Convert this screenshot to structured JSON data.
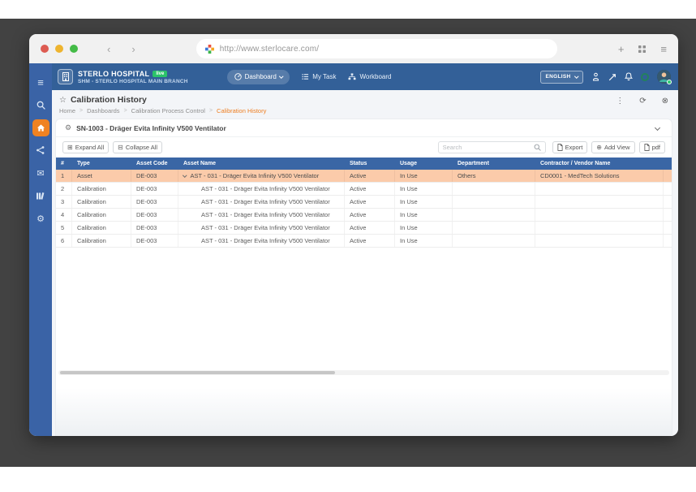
{
  "colors": {
    "accent_orange": "#ef8222",
    "appbar_blue": "#336098",
    "sidebar_blue": "#3a63a6",
    "table_header_blue": "#3a66a5",
    "row_highlight": "#fbcbaa",
    "live_green": "#2bc36a"
  },
  "browser": {
    "url": "http://www.sterlocare.com/"
  },
  "icons": {
    "hamburger": "≡",
    "plus": "+",
    "back": "‹",
    "forward": "›",
    "kebab": "⋮",
    "refresh": "⟳",
    "close_circle": "⊗",
    "star": "☆",
    "gear": "⚙",
    "mail": "✉",
    "add_view_plus": "⊕",
    "expand": "⊞",
    "collapse": "⊟"
  },
  "appbar": {
    "hospital_name": "STERLO HOSPITAL",
    "live_badge": "live",
    "branch": "SHM - STERLO HOSPITAL MAIN BRANCH",
    "nav": {
      "dashboard": "Dashboard",
      "my_task": "My Task",
      "workboard": "Workboard"
    },
    "language": "ENGLISH"
  },
  "page": {
    "title": "Calibration History",
    "breadcrumb": [
      "Home",
      "Dashboards",
      "Calibration Process Control",
      "Calibration History"
    ],
    "breadcrumb_separator": ">",
    "section_title": "SN-1003 - Dräger Evita Infinity V500 Ventilator"
  },
  "toolbar": {
    "expand_all": "Expand All",
    "collapse_all": "Collapse All",
    "search_placeholder": "Search",
    "export": "Export",
    "add_view": "Add View",
    "pdf": "pdf"
  },
  "table": {
    "columns": [
      "#",
      "Type",
      "Asset Code",
      "Asset Name",
      "Status",
      "Usage",
      "Department",
      "Contractor / Vendor Name",
      ""
    ],
    "rows": [
      {
        "cells": [
          "1",
          "Asset",
          "DE-003",
          "AST - 031 - Dräger Evita Infinity V500 Ventilator",
          "Active",
          "In Use",
          "Others",
          "CD0001 - MedTech Solutions",
          ""
        ],
        "caret": true,
        "highlight": true
      },
      {
        "cells": [
          "2",
          "Calibration",
          "DE-003",
          "AST - 031 - Dräger Evita Infinity V500 Ventilator",
          "Active",
          "In Use",
          "",
          "",
          ""
        ],
        "caret": false,
        "highlight": false
      },
      {
        "cells": [
          "3",
          "Calibration",
          "DE-003",
          "AST - 031 - Dräger Evita Infinity V500 Ventilator",
          "Active",
          "In Use",
          "",
          "",
          ""
        ],
        "caret": false,
        "highlight": false
      },
      {
        "cells": [
          "4",
          "Calibration",
          "DE-003",
          "AST - 031 - Dräger Evita Infinity V500 Ventilator",
          "Active",
          "In Use",
          "",
          "",
          ""
        ],
        "caret": false,
        "highlight": false
      },
      {
        "cells": [
          "5",
          "Calibration",
          "DE-003",
          "AST - 031 - Dräger Evita Infinity V500 Ventilator",
          "Active",
          "In Use",
          "",
          "",
          ""
        ],
        "caret": false,
        "highlight": false
      },
      {
        "cells": [
          "6",
          "Calibration",
          "DE-003",
          "AST - 031 - Dräger Evita Infinity V500 Ventilator",
          "Active",
          "In Use",
          "",
          "",
          ""
        ],
        "caret": false,
        "highlight": false
      }
    ]
  }
}
